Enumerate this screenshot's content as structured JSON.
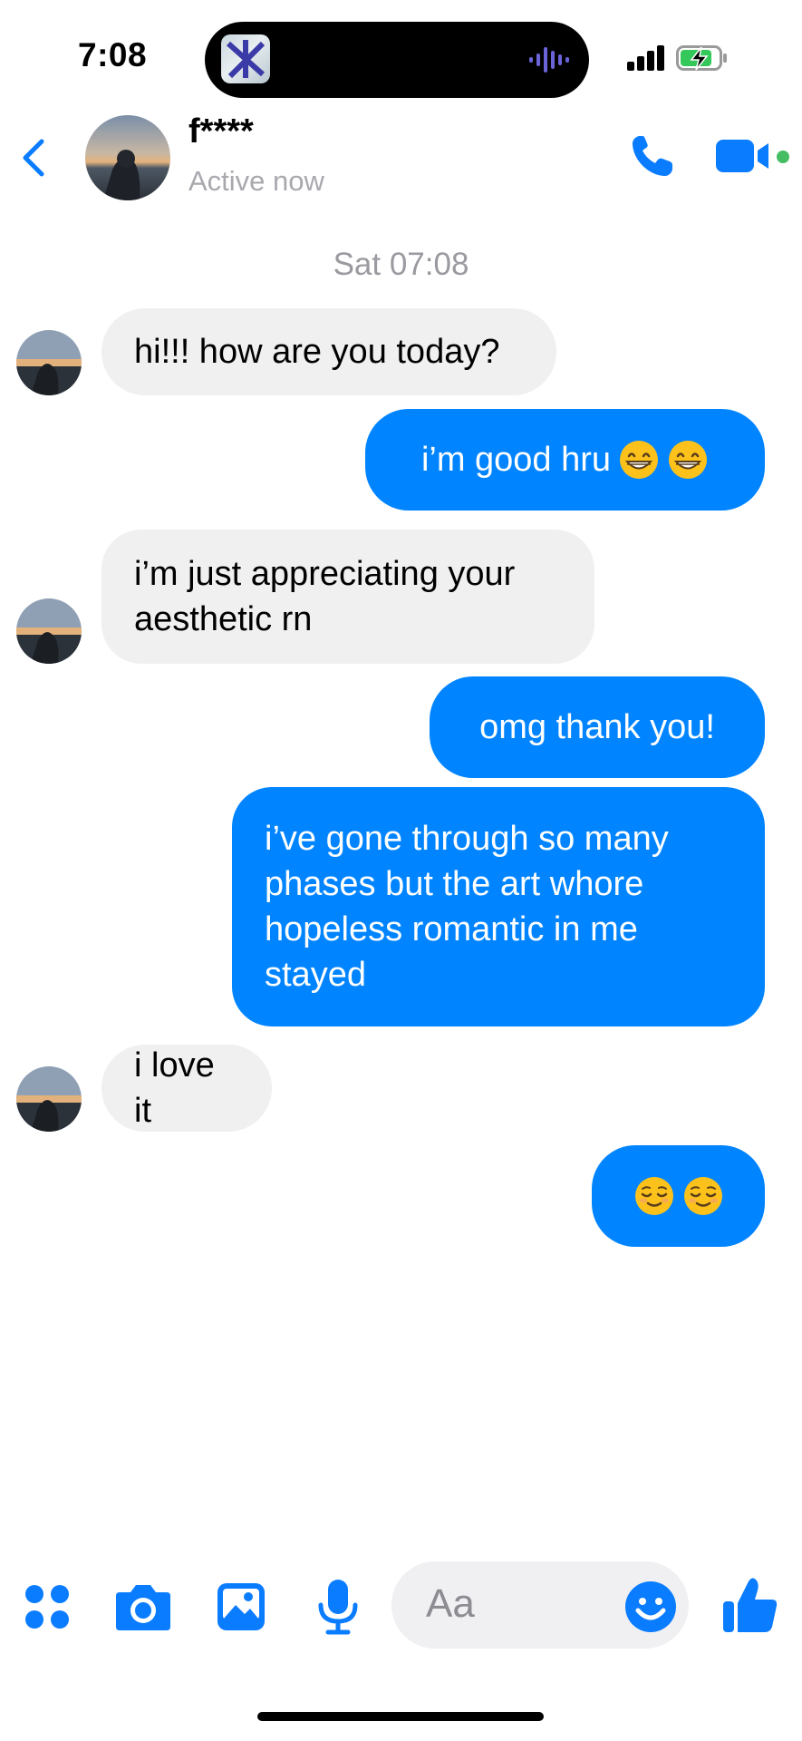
{
  "status_bar": {
    "time": "7:08"
  },
  "header": {
    "contact_name": "f****",
    "status": "Active now"
  },
  "date_separator": "Sat 07:08",
  "messages": [
    {
      "direction": "incoming",
      "lines": [
        "hi!!! how are you today?"
      ]
    },
    {
      "direction": "outgoing",
      "text": "i’m good hru",
      "emoji": "grinning-face"
    },
    {
      "direction": "incoming",
      "lines": [
        "i’m just appreciating your",
        "aesthetic rn"
      ]
    },
    {
      "direction": "outgoing",
      "lines": [
        "omg thank you!"
      ]
    },
    {
      "direction": "outgoing",
      "lines": [
        "i’ve gone through so many",
        "phases but the art whore",
        "hopeless romantic in me",
        "stayed"
      ]
    },
    {
      "direction": "incoming",
      "lines": [
        "i love it"
      ]
    },
    {
      "direction": "outgoing",
      "emoji": "relieved-face"
    }
  ],
  "composer": {
    "placeholder": "Aa"
  },
  "colors": {
    "accent": "#0084ff",
    "incoming_bubble": "#f0f0f0",
    "online": "#45bd62"
  }
}
